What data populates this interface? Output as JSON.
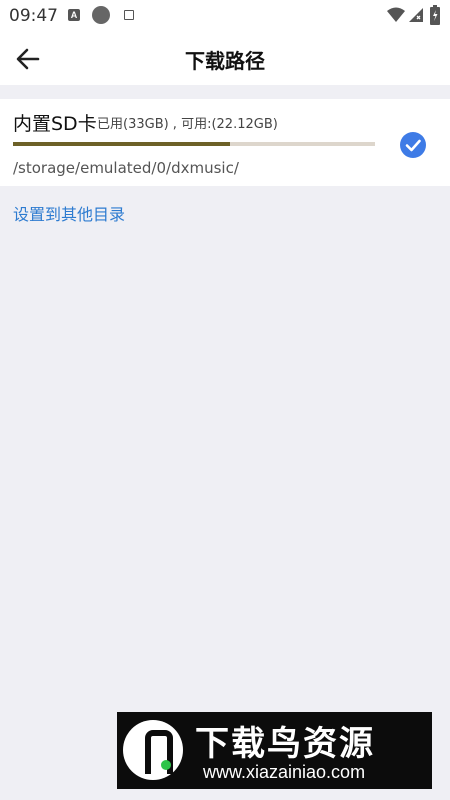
{
  "status_bar": {
    "time": "09:47",
    "notification_badge": "A",
    "icons": [
      "notification-a-icon",
      "circle-icon",
      "square-icon",
      "wifi-icon",
      "signal-icon",
      "battery-icon"
    ]
  },
  "header": {
    "title": "下载路径",
    "back_icon": "arrow-left-icon"
  },
  "storage": {
    "name": "内置SD卡",
    "usage": "已用(33GB) , 可用:(22.12GB)",
    "used_fraction": 0.6,
    "path": "/storage/emulated/0/dxmusic/",
    "selected": true
  },
  "actions": {
    "other_directory": "设置到其他目录"
  },
  "watermark": {
    "brand": "下载鸟资源",
    "url": "www.xiazainiao.com"
  },
  "colors": {
    "accent": "#3e7be6",
    "link": "#2d7bd0",
    "progress_fill": "#6d6127",
    "progress_track": "#ddd6cc",
    "background": "#efeff4"
  }
}
